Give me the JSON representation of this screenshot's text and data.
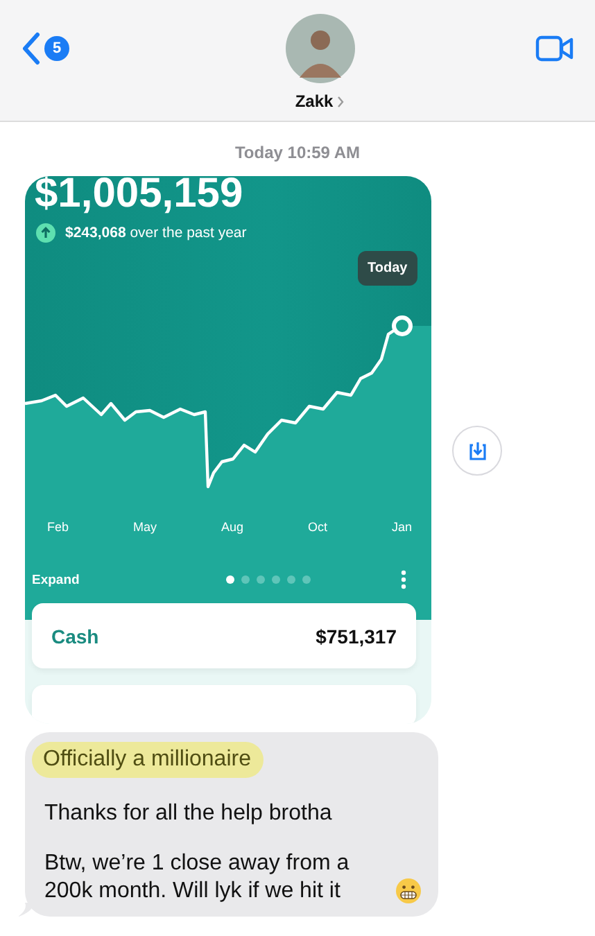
{
  "header": {
    "back_badge": "5",
    "contact_name": "Zakk"
  },
  "timestamp": "Today 10:59 AM",
  "screenshot": {
    "balance": "$1,005,159",
    "change": "**$243,068** over the past year",
    "tooltip": "Today",
    "months": [
      "Feb",
      "May",
      "Aug",
      "Oct",
      "Jan"
    ],
    "expand": "Expand",
    "pages": [
      {
        "selected": true
      },
      {
        "selected": false
      },
      {
        "selected": false
      },
      {
        "selected": false
      },
      {
        "selected": false
      },
      {
        "selected": false
      }
    ],
    "accounts": [
      {
        "name": "Cash",
        "amount": "$751,317"
      }
    ]
  },
  "message": {
    "highlight": "Officially a millionaire",
    "paragraphs": [
      "Thanks for all the help brotha",
      "Btw, we’re 1 close away from a 200k month. Will lyk if we hit it"
    ]
  }
}
